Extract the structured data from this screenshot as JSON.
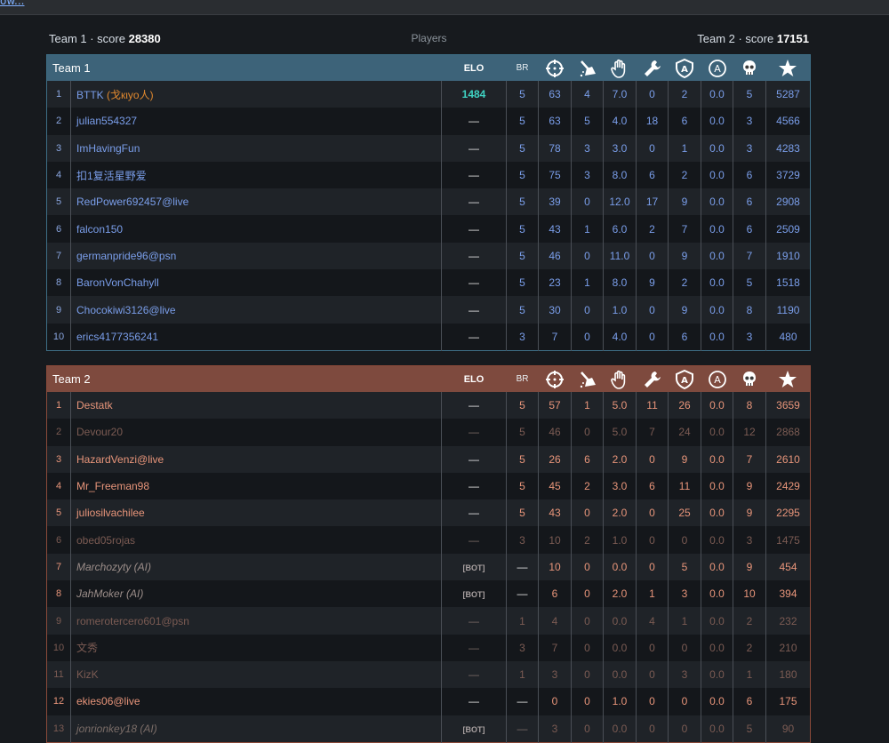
{
  "header": {
    "team1_prefix": "Team 1 · score ",
    "team1_score": "28380",
    "players_label": "Players",
    "team2_prefix": "Team 2 · score ",
    "team2_score": "17151"
  },
  "columns": {
    "elo": "ELO",
    "br": "BR",
    "icons": [
      "crosshair-icon",
      "sweep-icon",
      "hand-icon",
      "wrench-icon",
      "shield-a-icon",
      "circle-a-icon",
      "skull-icon",
      "star-icon"
    ]
  },
  "colors": {
    "team1_header": "#3d6379",
    "team2_header": "#7e4a3e",
    "team1_text": "#7a9eea",
    "team2_text": "#e8957a",
    "elo_highlight": "#3fd3c3",
    "clan_tag": "#e0882e"
  },
  "team1": {
    "title": "Team 1",
    "rows": [
      {
        "idx": "1",
        "name": "BTTK",
        "clan": "(戈кιуο人)",
        "elo": "1484",
        "br": "5",
        "c1": "63",
        "c2": "4",
        "c3": "7.0",
        "c4": "0",
        "c5": "2",
        "c6": "0.0",
        "c7": "5",
        "c8": "5287"
      },
      {
        "idx": "2",
        "name": "julian554327",
        "elo": "—",
        "br": "5",
        "c1": "63",
        "c2": "5",
        "c3": "4.0",
        "c4": "18",
        "c5": "6",
        "c6": "0.0",
        "c7": "3",
        "c8": "4566"
      },
      {
        "idx": "3",
        "name": "ImHavingFun",
        "elo": "—",
        "br": "5",
        "c1": "78",
        "c2": "3",
        "c3": "3.0",
        "c4": "0",
        "c5": "1",
        "c6": "0.0",
        "c7": "3",
        "c8": "4283"
      },
      {
        "idx": "4",
        "name": "扣1复活星野爱",
        "elo": "—",
        "br": "5",
        "c1": "75",
        "c2": "3",
        "c3": "8.0",
        "c4": "6",
        "c5": "2",
        "c6": "0.0",
        "c7": "6",
        "c8": "3729"
      },
      {
        "idx": "5",
        "name": "RedPower692457@live",
        "elo": "—",
        "br": "5",
        "c1": "39",
        "c2": "0",
        "c3": "12.0",
        "c4": "17",
        "c5": "9",
        "c6": "0.0",
        "c7": "6",
        "c8": "2908"
      },
      {
        "idx": "6",
        "name": "falcon150",
        "elo": "—",
        "br": "5",
        "c1": "43",
        "c2": "1",
        "c3": "6.0",
        "c4": "2",
        "c5": "7",
        "c6": "0.0",
        "c7": "6",
        "c8": "2509"
      },
      {
        "idx": "7",
        "name": "germanpride96@psn",
        "elo": "—",
        "br": "5",
        "c1": "46",
        "c2": "0",
        "c3": "11.0",
        "c4": "0",
        "c5": "9",
        "c6": "0.0",
        "c7": "7",
        "c8": "1910"
      },
      {
        "idx": "8",
        "name": "BaronVonChahyll",
        "elo": "—",
        "br": "5",
        "c1": "23",
        "c2": "1",
        "c3": "8.0",
        "c4": "9",
        "c5": "2",
        "c6": "0.0",
        "c7": "5",
        "c8": "1518"
      },
      {
        "idx": "9",
        "name": "Chocokiwi3126@live",
        "elo": "—",
        "br": "5",
        "c1": "30",
        "c2": "0",
        "c3": "1.0",
        "c4": "0",
        "c5": "9",
        "c6": "0.0",
        "c7": "8",
        "c8": "1190"
      },
      {
        "idx": "10",
        "name": "erics4177356241",
        "elo": "—",
        "br": "3",
        "c1": "7",
        "c2": "0",
        "c3": "4.0",
        "c4": "0",
        "c5": "6",
        "c6": "0.0",
        "c7": "3",
        "c8": "480"
      }
    ]
  },
  "team2": {
    "title": "Team 2",
    "rows": [
      {
        "idx": "1",
        "name": "Destatk",
        "elo": "—",
        "br": "5",
        "c1": "57",
        "c2": "1",
        "c3": "5.0",
        "c4": "11",
        "c5": "26",
        "c6": "0.0",
        "c7": "8",
        "c8": "3659",
        "style": ""
      },
      {
        "idx": "2",
        "name": "Devour20",
        "elo": "—",
        "br": "5",
        "c1": "46",
        "c2": "0",
        "c3": "5.0",
        "c4": "7",
        "c5": "24",
        "c6": "0.0",
        "c7": "12",
        "c8": "2868",
        "style": "dim"
      },
      {
        "idx": "3",
        "name": "HazardVenzi@live",
        "elo": "—",
        "br": "5",
        "c1": "26",
        "c2": "6",
        "c3": "2.0",
        "c4": "0",
        "c5": "9",
        "c6": "0.0",
        "c7": "7",
        "c8": "2610",
        "style": ""
      },
      {
        "idx": "4",
        "name": "Mr_Freeman98",
        "elo": "—",
        "br": "5",
        "c1": "45",
        "c2": "2",
        "c3": "3.0",
        "c4": "6",
        "c5": "11",
        "c6": "0.0",
        "c7": "9",
        "c8": "2429",
        "style": ""
      },
      {
        "idx": "5",
        "name": "juliosilvachilee",
        "elo": "—",
        "br": "5",
        "c1": "43",
        "c2": "0",
        "c3": "2.0",
        "c4": "0",
        "c5": "25",
        "c6": "0.0",
        "c7": "9",
        "c8": "2295",
        "style": ""
      },
      {
        "idx": "6",
        "name": "obed05rojas",
        "elo": "—",
        "br": "3",
        "c1": "10",
        "c2": "2",
        "c3": "1.0",
        "c4": "0",
        "c5": "0",
        "c6": "0.0",
        "c7": "3",
        "c8": "1475",
        "style": "dim"
      },
      {
        "idx": "7",
        "name": "Marchozyty (AI)",
        "elo": "[BOT]",
        "br": "—",
        "c1": "10",
        "c2": "0",
        "c3": "0.0",
        "c4": "0",
        "c5": "5",
        "c6": "0.0",
        "c7": "9",
        "c8": "454",
        "style": "ai"
      },
      {
        "idx": "8",
        "name": "JahMoker (AI)",
        "elo": "[BOT]",
        "br": "—",
        "c1": "6",
        "c2": "0",
        "c3": "2.0",
        "c4": "1",
        "c5": "3",
        "c6": "0.0",
        "c7": "10",
        "c8": "394",
        "style": "ai"
      },
      {
        "idx": "9",
        "name": "romerotercero601@psn",
        "elo": "—",
        "br": "1",
        "c1": "4",
        "c2": "0",
        "c3": "0.0",
        "c4": "4",
        "c5": "1",
        "c6": "0.0",
        "c7": "2",
        "c8": "232",
        "style": "dim"
      },
      {
        "idx": "10",
        "name": "文秀",
        "elo": "—",
        "br": "3",
        "c1": "7",
        "c2": "0",
        "c3": "0.0",
        "c4": "0",
        "c5": "0",
        "c6": "0.0",
        "c7": "2",
        "c8": "210",
        "style": "dim"
      },
      {
        "idx": "11",
        "name": "KizK",
        "elo": "—",
        "br": "1",
        "c1": "3",
        "c2": "0",
        "c3": "0.0",
        "c4": "0",
        "c5": "3",
        "c6": "0.0",
        "c7": "1",
        "c8": "180",
        "style": "dim"
      },
      {
        "idx": "12",
        "name": "ekies06@live",
        "elo": "—",
        "br": "—",
        "c1": "0",
        "c2": "0",
        "c3": "1.0",
        "c4": "0",
        "c5": "0",
        "c6": "0.0",
        "c7": "6",
        "c8": "175",
        "style": ""
      },
      {
        "idx": "13",
        "name": "jonrionkey18 (AI)",
        "elo": "[BOT]",
        "br": "—",
        "c1": "3",
        "c2": "0",
        "c3": "0.0",
        "c4": "0",
        "c5": "0",
        "c6": "0.0",
        "c7": "5",
        "c8": "90",
        "style": "dimai"
      }
    ]
  }
}
